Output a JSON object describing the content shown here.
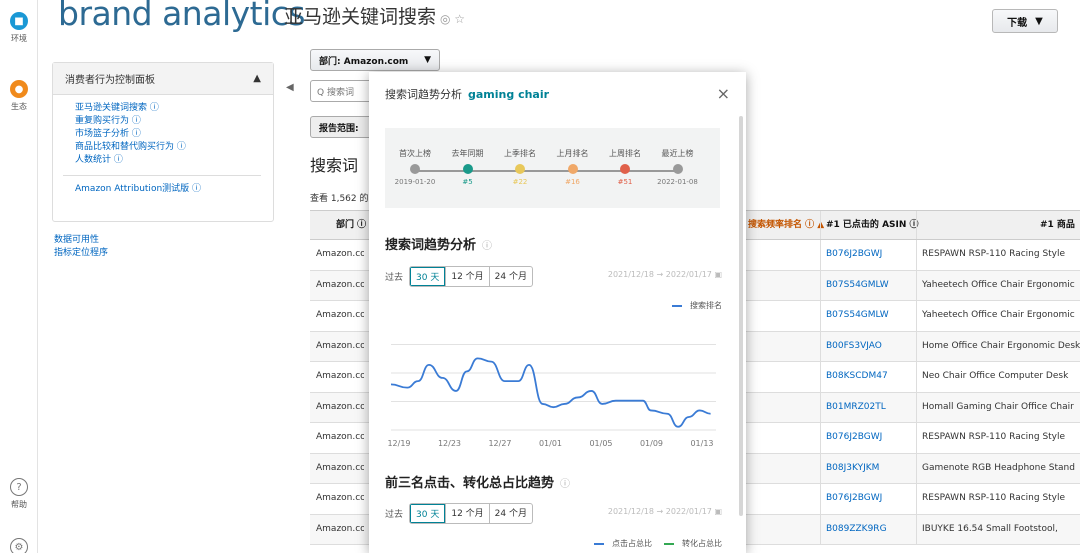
{
  "rail": {
    "items": [
      {
        "label": "环境",
        "color": "#1a98d5",
        "icon": "chat-icon"
      },
      {
        "label": "生态",
        "color": "#f08a1c",
        "icon": "user-icon"
      },
      {
        "label": "帮助",
        "color": "#ffffff",
        "icon": "help-icon"
      }
    ]
  },
  "header": {
    "brand": "brand analytics",
    "title": "亚马逊关键词搜索",
    "title_icons": "◎ ☆",
    "download": "下载"
  },
  "left_panel": {
    "heading": "消费者行为控制面板",
    "items": [
      "亚马逊关键词搜索 ⓘ",
      "重复购买行为 ⓘ",
      "市场篮子分析 ⓘ",
      "商品比较和替代购买行为 ⓘ",
      "人数统计 ⓘ"
    ],
    "attribution": "Amazon Attribution测试版 ⓘ",
    "links": [
      "数据可用性",
      "指标定位程序"
    ]
  },
  "controls": {
    "department": "部门: Amazon.com",
    "search_placeholder": "Q 搜索词",
    "report_scope": "报告范围: ",
    "section_title": "搜索词",
    "count": "查看 1,562 的"
  },
  "table": {
    "headers": {
      "dept": "部门 ⓘ",
      "rank": "搜索频率排名 ⓘ ▲",
      "asin": "#1 已点击的 ASIN ⓘ",
      "name": "#1 商品"
    },
    "rows": [
      {
        "dept": "Amazon.com",
        "asin": "B076J2BGWJ",
        "name": "RESPAWN RSP-110 Racing Style"
      },
      {
        "dept": "Amazon.com",
        "asin": "B07S54GMLW",
        "name": "Yaheetech Office Chair Ergonomic"
      },
      {
        "dept": "Amazon.com",
        "asin": "B07S54GMLW",
        "name": "Yaheetech Office Chair Ergonomic"
      },
      {
        "dept": "Amazon.com",
        "asin": "B00FS3VJAO",
        "name": "Home Office Chair Ergonomic Desk"
      },
      {
        "dept": "Amazon.com",
        "asin": "B08KSCDM47",
        "name": "Neo Chair Office Computer Desk"
      },
      {
        "dept": "Amazon.com",
        "asin": "B01MRZ02TL",
        "name": "Homall Gaming Chair Office Chair"
      },
      {
        "dept": "Amazon.com",
        "asin": "B076J2BGWJ",
        "name": "RESPAWN RSP-110 Racing Style"
      },
      {
        "dept": "Amazon.com",
        "asin": "B08J3KYJKM",
        "name": "Gamenote RGB Headphone Stand"
      },
      {
        "dept": "Amazon.com",
        "asin": "B076J2BGWJ",
        "name": "RESPAWN RSP-110 Racing Style"
      },
      {
        "dept": "Amazon.com",
        "asin": "B089ZZK9RG",
        "name": "IBUYKE 16.54 Small Footstool,"
      }
    ]
  },
  "modal": {
    "title": "搜索词趋势分析",
    "keyword": "gaming chair",
    "close": "×",
    "timeline": [
      {
        "label": "首次上榜",
        "value": "2019-01-20",
        "color": "#999999"
      },
      {
        "label": "去年同期",
        "value": "#5",
        "color": "#1a9a8a"
      },
      {
        "label": "上季排名",
        "value": "#22",
        "color": "#e8c85a"
      },
      {
        "label": "上月排名",
        "value": "#16",
        "color": "#f0a868"
      },
      {
        "label": "上周排名",
        "value": "#51",
        "color": "#e0604a"
      },
      {
        "label": "最近上榜",
        "value": "2022-01-08",
        "color": "#999999"
      }
    ],
    "section1": {
      "title": "搜索词趋势分析",
      "range_label": "过去",
      "ranges": [
        "30 天",
        "12 个月",
        "24 个月"
      ],
      "date_range": "2021/12/18 → 2022/01/17",
      "legend": "搜索排名"
    },
    "section2": {
      "title": "前三名点击、转化总占比趋势",
      "range_label": "过去",
      "ranges": [
        "30 天",
        "12 个月",
        "24 个月"
      ],
      "date_range": "2021/12/18 → 2022/01/17",
      "legend_a": "点击占总比",
      "legend_b": "转化占总比"
    }
  },
  "chart_data": {
    "type": "line",
    "title": "",
    "x": [
      "12/19",
      "12/23",
      "12/27",
      "01/01",
      "01/05",
      "01/09",
      "01/13"
    ],
    "series": [
      {
        "name": "搜索排名",
        "color": "#3a7bd5",
        "points": [
          [
            0,
            42
          ],
          [
            1.2,
            44
          ],
          [
            2.0,
            40
          ],
          [
            2.8,
            30
          ],
          [
            3.8,
            38
          ],
          [
            4.8,
            46
          ],
          [
            5.6,
            34
          ],
          [
            6.4,
            26
          ],
          [
            7.4,
            28
          ],
          [
            8.4,
            40
          ],
          [
            9.4,
            40
          ],
          [
            10.2,
            30
          ],
          [
            11.2,
            54
          ],
          [
            12.0,
            56
          ],
          [
            12.8,
            54
          ],
          [
            13.8,
            50
          ],
          [
            14.8,
            46
          ],
          [
            15.6,
            54
          ],
          [
            16.6,
            52
          ],
          [
            17.6,
            52
          ],
          [
            18.6,
            52
          ],
          [
            19.2,
            58
          ],
          [
            20.4,
            60
          ],
          [
            21.2,
            68
          ],
          [
            22.0,
            62
          ],
          [
            22.8,
            58
          ],
          [
            23.6,
            60
          ]
        ]
      }
    ],
    "xlim": [
      0,
      24
    ],
    "ylim": [
      0,
      70
    ],
    "y_inverted": true,
    "grid": true,
    "legend_position": "top-right"
  }
}
